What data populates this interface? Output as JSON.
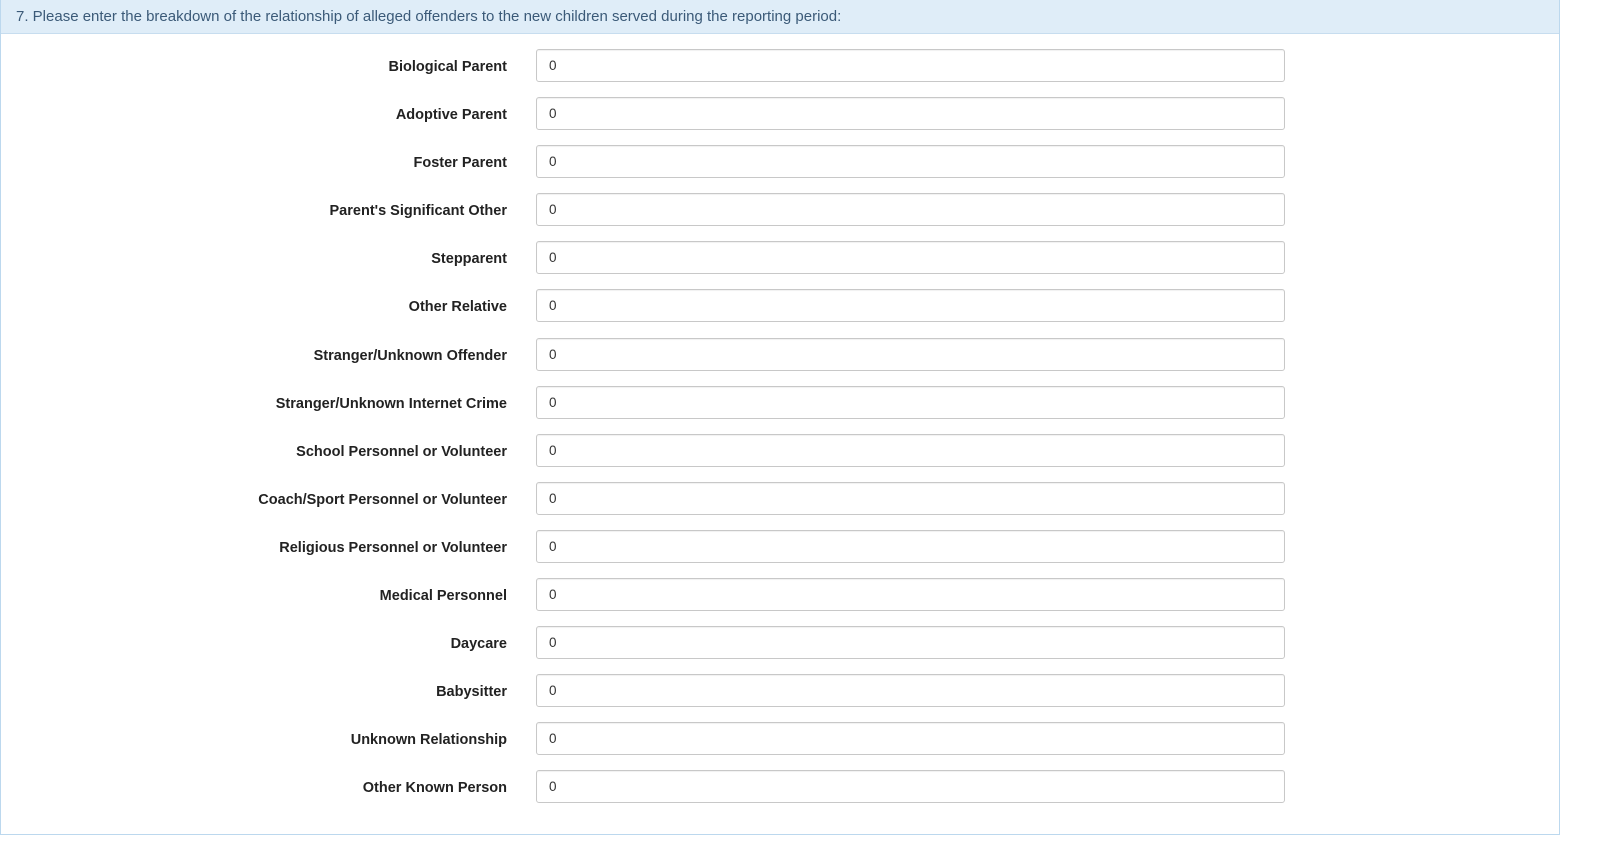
{
  "question": {
    "text": "7. Please enter the breakdown of the relationship of alleged offenders to the new children served during the reporting period:"
  },
  "fields": [
    {
      "label": "Biological Parent",
      "value": "0"
    },
    {
      "label": "Adoptive Parent",
      "value": "0"
    },
    {
      "label": "Foster Parent",
      "value": "0"
    },
    {
      "label": "Parent's Significant Other",
      "value": "0"
    },
    {
      "label": "Stepparent",
      "value": "0"
    },
    {
      "label": "Other Relative",
      "value": "0"
    },
    {
      "label": "Stranger/Unknown Offender",
      "value": "0"
    },
    {
      "label": "Stranger/Unknown Internet Crime",
      "value": "0"
    },
    {
      "label": "School Personnel or Volunteer",
      "value": "0"
    },
    {
      "label": "Coach/Sport Personnel or Volunteer",
      "value": "0"
    },
    {
      "label": "Religious Personnel or Volunteer",
      "value": "0"
    },
    {
      "label": "Medical Personnel",
      "value": "0"
    },
    {
      "label": "Daycare",
      "value": "0"
    },
    {
      "label": "Babysitter",
      "value": "0"
    },
    {
      "label": "Unknown Relationship",
      "value": "0"
    },
    {
      "label": "Other Known Person",
      "value": "0"
    }
  ],
  "colors": {
    "heading_bg": "#dfedf8",
    "heading_text": "#3b5a78",
    "panel_border": "#bcd8ee",
    "input_border": "#c8c8c8"
  }
}
